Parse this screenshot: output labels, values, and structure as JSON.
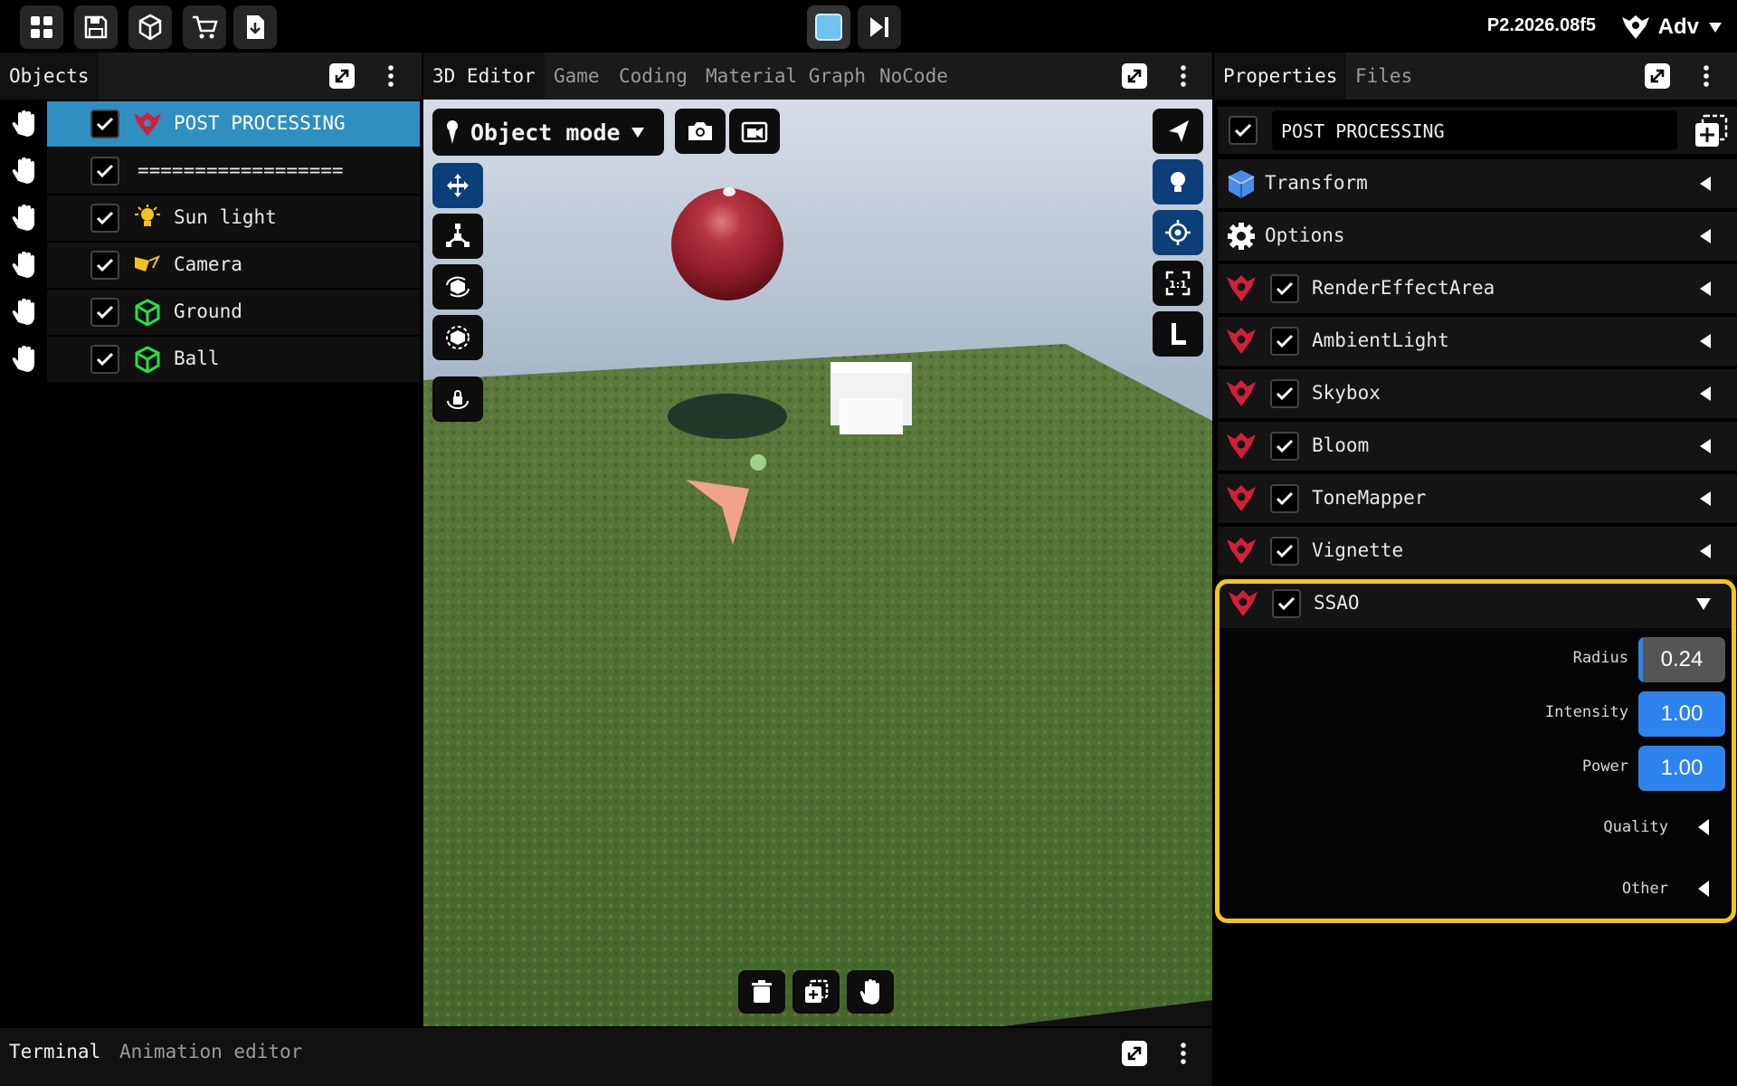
{
  "topbar": {
    "version": "P2.2026.08f5",
    "user": "Adv"
  },
  "objects": {
    "tab": "Objects",
    "items": [
      {
        "label": "POST PROCESSING",
        "selected": true,
        "icon": "post-processing-icon"
      },
      {
        "label": "==================",
        "selected": false,
        "icon": ""
      },
      {
        "label": "Sun light",
        "selected": false,
        "icon": "lightbulb-icon"
      },
      {
        "label": "Camera",
        "selected": false,
        "icon": "camera-icon"
      },
      {
        "label": "Ground",
        "selected": false,
        "icon": "mesh-icon"
      },
      {
        "label": "Ball",
        "selected": false,
        "icon": "mesh-icon"
      }
    ]
  },
  "editor": {
    "tabs": [
      "3D Editor",
      "Game",
      "Coding",
      "Material Graph",
      "NoCode"
    ],
    "active_tab": "3D Editor",
    "mode": "Object mode"
  },
  "properties": {
    "tabs": [
      "Properties",
      "Files"
    ],
    "object_name": "POST PROCESSING",
    "sections": [
      "Transform",
      "Options"
    ],
    "components": [
      "RenderEffectArea",
      "AmbientLight",
      "Skybox",
      "Bloom",
      "ToneMapper",
      "Vignette",
      "SSAO"
    ],
    "ssao": {
      "fields": {
        "radius_label": "Radius",
        "radius_value": "0.24",
        "radius_fraction": 0.24,
        "intensity_label": "Intensity",
        "intensity_value": "1.00",
        "power_label": "Power",
        "power_value": "1.00"
      },
      "subsections": [
        "Quality",
        "Other"
      ]
    }
  },
  "bottom": {
    "tabs": [
      "Terminal",
      "Animation editor"
    ]
  },
  "colors": {
    "accent": "#2e83ee",
    "selected_row": "#2f8fc0",
    "highlight": "#f5c518",
    "component_icon": "#c8102e"
  }
}
